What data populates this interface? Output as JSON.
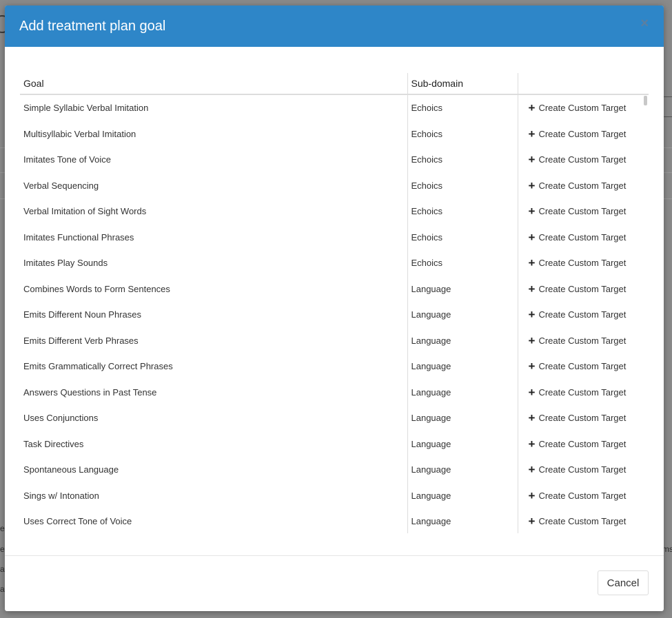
{
  "modal": {
    "title": "Add treatment plan goal",
    "close_label": "×"
  },
  "table": {
    "headers": {
      "goal": "Goal",
      "subdomain": "Sub-domain",
      "action": ""
    },
    "action_label": "Create Custom Target",
    "rows": [
      {
        "goal": "Simple Syllabic Verbal Imitation",
        "subdomain": "Echoics"
      },
      {
        "goal": "Multisyllabic Verbal Imitation",
        "subdomain": "Echoics"
      },
      {
        "goal": "Imitates Tone of Voice",
        "subdomain": "Echoics"
      },
      {
        "goal": "Verbal Sequencing",
        "subdomain": "Echoics"
      },
      {
        "goal": "Verbal Imitation of Sight Words",
        "subdomain": "Echoics"
      },
      {
        "goal": "Imitates Functional Phrases",
        "subdomain": "Echoics"
      },
      {
        "goal": "Imitates Play Sounds",
        "subdomain": "Echoics"
      },
      {
        "goal": "Combines Words to Form Sentences",
        "subdomain": "Language"
      },
      {
        "goal": "Emits Different Noun Phrases",
        "subdomain": "Language"
      },
      {
        "goal": "Emits Different Verb Phrases",
        "subdomain": "Language"
      },
      {
        "goal": "Emits Grammatically Correct Phrases",
        "subdomain": "Language"
      },
      {
        "goal": "Answers Questions in Past Tense",
        "subdomain": "Language"
      },
      {
        "goal": "Uses Conjunctions",
        "subdomain": "Language"
      },
      {
        "goal": "Task Directives",
        "subdomain": "Language"
      },
      {
        "goal": "Spontaneous Language",
        "subdomain": "Language"
      },
      {
        "goal": "Sings w/ Intonation",
        "subdomain": "Language"
      },
      {
        "goal": "Uses Correct Tone of Voice",
        "subdomain": "Language"
      }
    ]
  },
  "footer": {
    "cancel_label": "Cancel"
  },
  "colors": {
    "header_bg": "#2e86c8",
    "header_text": "#ffffff",
    "close_icon": "#5c7fa0"
  },
  "backdrop": {
    "fragments": [
      "e",
      "e",
      "a",
      "a",
      "ms"
    ]
  }
}
